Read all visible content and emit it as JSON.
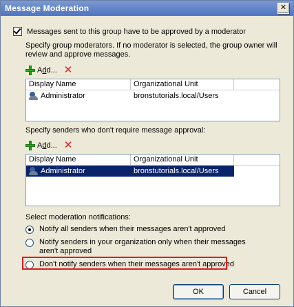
{
  "window": {
    "title": "Message Moderation",
    "close_glyph": "✕"
  },
  "moderation": {
    "checkbox_label": "Messages sent to this group have to be approved by a moderator",
    "checked": true
  },
  "moderators": {
    "description": "Specify group moderators. If no moderator is selected, the group owner will review and approve messages.",
    "add_label_pre": "A",
    "add_label_underline": "d",
    "add_label_post": "d...",
    "columns": [
      "Display Name",
      "Organizational Unit"
    ],
    "rows": [
      {
        "name": "Administrator",
        "ou": "bronstutorials.local/Users",
        "selected": false
      }
    ]
  },
  "senders": {
    "description": "Specify senders who don't require message approval:",
    "add_label_pre": "A",
    "add_label_underline": "d",
    "add_label_post": "d...",
    "columns": [
      "Display Name",
      "Organizational Unit"
    ],
    "rows": [
      {
        "name": "Administrator",
        "ou": "bronstutorials.local/Users",
        "selected": true
      }
    ]
  },
  "notifications": {
    "label": "Select moderation notifications:",
    "options": [
      {
        "label": "Notify all senders when their messages aren't approved",
        "selected": true
      },
      {
        "label": "Notify senders in your organization only when their messages aren't approved",
        "selected": false
      },
      {
        "label": "Don't notify senders when their messages aren't approved",
        "selected": false
      }
    ],
    "highlight_color": "#e21b1b"
  },
  "buttons": {
    "ok": "OK",
    "cancel": "Cancel"
  },
  "icons": {
    "add": "add-icon",
    "remove": "remove-icon",
    "user": "user-icon"
  },
  "colors": {
    "selection": "#0a246a",
    "titlebar": "#4f74c2"
  }
}
